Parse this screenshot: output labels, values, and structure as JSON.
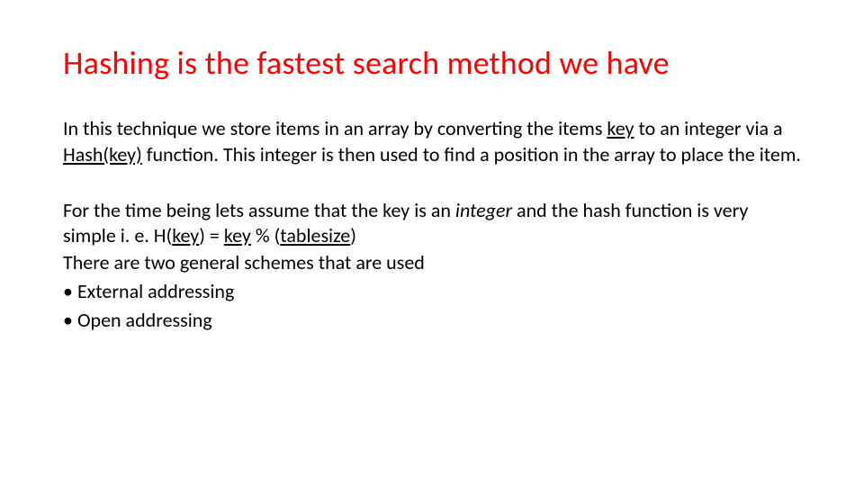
{
  "title": "Hashing is the fastest search method we have",
  "para1": {
    "t1": "In this technique we store items in an array by converting the items ",
    "key": "key",
    "t2": " to an integer via a ",
    "hash": "Hash(key)",
    "t3": " function.  This integer is then used to find a position in the array to place the item."
  },
  "para2": {
    "t1": "For the time being lets assume that the key is an ",
    "integer": "integer",
    "t2": " and the hash function is very simple i. e.   H(",
    "key": "key",
    "t3": ") = ",
    "key2": "key",
    "t4": " % (",
    "tablesize": "tablesize",
    "t5": ")"
  },
  "schemes_intro": "There are two general schemes that are used",
  "bullets": {
    "0": "External addressing",
    "1": "Open addressing"
  }
}
